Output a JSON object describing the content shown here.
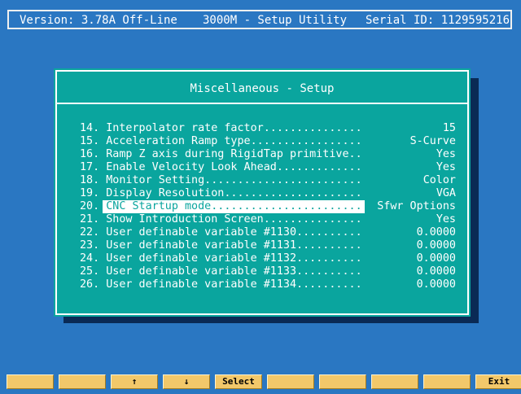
{
  "header": {
    "version": "Version: 3.78A Off-Line",
    "title": "3000M - Setup Utility",
    "serial": "Serial ID: 1129595216"
  },
  "dialog": {
    "title": "Miscellaneous - Setup",
    "selected_index": 6,
    "rows": [
      {
        "num": "14.",
        "label": "Interpolator rate factor...............",
        "value": "15"
      },
      {
        "num": "15.",
        "label": "Acceleration Ramp type.................",
        "value": "S-Curve"
      },
      {
        "num": "16.",
        "label": "Ramp Z axis during RigidTap primitive..",
        "value": "Yes"
      },
      {
        "num": "17.",
        "label": "Enable Velocity Look Ahead.............",
        "value": "Yes"
      },
      {
        "num": "18.",
        "label": "Monitor Setting........................",
        "value": "Color"
      },
      {
        "num": "19.",
        "label": "Display Resolution.....................",
        "value": "VGA"
      },
      {
        "num": "20.",
        "label": "CNC Startup mode.......................",
        "value": "Sfwr Options"
      },
      {
        "num": "21.",
        "label": "Show Introduction Screen...............",
        "value": "Yes"
      },
      {
        "num": "22.",
        "label": "User definable variable #1130..........",
        "value": "0.0000"
      },
      {
        "num": "23.",
        "label": "User definable variable #1131..........",
        "value": "0.0000"
      },
      {
        "num": "24.",
        "label": "User definable variable #1132..........",
        "value": "0.0000"
      },
      {
        "num": "25.",
        "label": "User definable variable #1133..........",
        "value": "0.0000"
      },
      {
        "num": "26.",
        "label": "User definable variable #1134..........",
        "value": "0.0000"
      }
    ]
  },
  "fkeys": [
    {
      "label": "",
      "name": "fkey-f1"
    },
    {
      "label": "",
      "name": "fkey-f2"
    },
    {
      "label": "↑",
      "name": "fkey-up"
    },
    {
      "label": "↓",
      "name": "fkey-down"
    },
    {
      "label": "Select",
      "name": "fkey-select"
    },
    {
      "label": "",
      "name": "fkey-f6"
    },
    {
      "label": "",
      "name": "fkey-f7"
    },
    {
      "label": "",
      "name": "fkey-f8"
    },
    {
      "label": "",
      "name": "fkey-f9"
    },
    {
      "label": "Exit",
      "name": "fkey-exit"
    }
  ],
  "colors": {
    "background": "#2a77c2",
    "dialog": "#0aa59e",
    "fkey": "#f2c86a",
    "text": "#ffffff"
  }
}
